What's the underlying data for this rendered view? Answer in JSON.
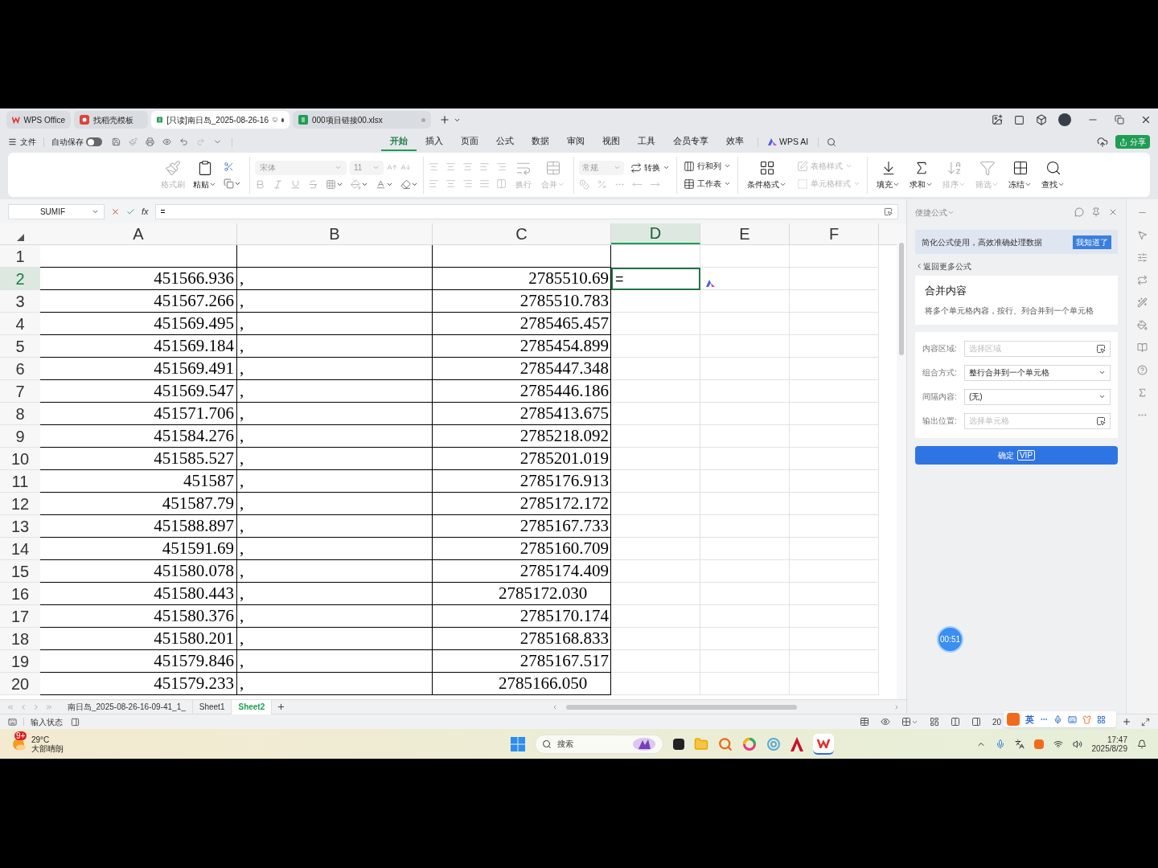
{
  "tabs": [
    {
      "label": "WPS Office",
      "kind": "home",
      "selected": false
    },
    {
      "label": "找稻壳模板",
      "kind": "template",
      "selected": false
    },
    {
      "label": "[只读]南日岛_2025-08-26-16",
      "kind": "sheet",
      "selected": true
    },
    {
      "label": "000项目链接00.xlsx",
      "kind": "sheet",
      "selected": false
    }
  ],
  "menu": {
    "file": "文件",
    "autosave": {
      "label": "自动保存",
      "on": false
    }
  },
  "ribbon_tabs": [
    {
      "label": "开始",
      "selected": true
    },
    {
      "label": "插入",
      "selected": false
    },
    {
      "label": "页面",
      "selected": false
    },
    {
      "label": "公式",
      "selected": false
    },
    {
      "label": "数据",
      "selected": false
    },
    {
      "label": "审阅",
      "selected": false
    },
    {
      "label": "视图",
      "selected": false
    },
    {
      "label": "工具",
      "selected": false
    },
    {
      "label": "会员专享",
      "selected": false
    },
    {
      "label": "效率",
      "selected": false
    }
  ],
  "ai_tab": "WPS AI",
  "share": "分享",
  "ribbon": {
    "groups": [
      {
        "kind": "clipboard",
        "items": [
          {
            "label": "格式刷",
            "disabled": true
          },
          {
            "label": "粘贴",
            "disabled": false
          }
        ]
      },
      {
        "kind": "font",
        "font": "宋体",
        "size": "11"
      },
      {
        "kind": "align",
        "items": [
          {
            "label": "换行",
            "disabled": true
          },
          {
            "label": "合并",
            "disabled": true
          }
        ]
      },
      {
        "kind": "number",
        "format": "常规",
        "items": [
          {
            "label": "转换",
            "disabled": false
          }
        ]
      },
      {
        "kind": "cells",
        "items": [
          {
            "label": "行和列",
            "disabled": false
          },
          {
            "label": "工作表",
            "disabled": false
          }
        ]
      },
      {
        "kind": "styles",
        "items": [
          {
            "label": "条件格式",
            "disabled": false
          },
          {
            "label": "表格样式",
            "disabled": true
          },
          {
            "label": "单元格样式",
            "disabled": true
          }
        ]
      },
      {
        "kind": "edit",
        "items": [
          {
            "label": "填充",
            "disabled": false
          },
          {
            "label": "求和",
            "disabled": false
          },
          {
            "label": "排序",
            "disabled": true
          },
          {
            "label": "筛选",
            "disabled": true
          },
          {
            "label": "冻结",
            "disabled": false
          },
          {
            "label": "查找",
            "disabled": false
          }
        ]
      }
    ]
  },
  "formula_bar": {
    "name_box": "SUMIF",
    "function_label": "fx",
    "formula": "="
  },
  "sheet": {
    "columns": [
      {
        "label": "A",
        "selected": false
      },
      {
        "label": "B",
        "selected": false
      },
      {
        "label": "C",
        "selected": false
      },
      {
        "label": "D",
        "selected": true
      },
      {
        "label": "E",
        "selected": false
      },
      {
        "label": "F",
        "selected": false
      }
    ],
    "active_cell": {
      "value": "="
    },
    "rows": [
      {
        "number": "1",
        "selected": false
      },
      {
        "number": "2",
        "selected": true,
        "a": "451566.936",
        "b": ",",
        "c": "2785510.69",
        "c_left_aligned": false
      },
      {
        "number": "3",
        "selected": false,
        "a": "451567.266",
        "b": ",",
        "c": "2785510.783",
        "c_left_aligned": false
      },
      {
        "number": "4",
        "selected": false,
        "a": "451569.495",
        "b": ",",
        "c": "2785465.457",
        "c_left_aligned": false
      },
      {
        "number": "5",
        "selected": false,
        "a": "451569.184",
        "b": ",",
        "c": "2785454.899",
        "c_left_aligned": false
      },
      {
        "number": "6",
        "selected": false,
        "a": "451569.491",
        "b": ",",
        "c": "2785447.348",
        "c_left_aligned": false
      },
      {
        "number": "7",
        "selected": false,
        "a": "451569.547",
        "b": ",",
        "c": "2785446.186",
        "c_left_aligned": false
      },
      {
        "number": "8",
        "selected": false,
        "a": "451571.706",
        "b": ",",
        "c": "2785413.675",
        "c_left_aligned": false
      },
      {
        "number": "9",
        "selected": false,
        "a": "451584.276",
        "b": ",",
        "c": "2785218.092",
        "c_left_aligned": false
      },
      {
        "number": "10",
        "selected": false,
        "a": "451585.527",
        "b": ",",
        "c": "2785201.019",
        "c_left_aligned": false
      },
      {
        "number": "11",
        "selected": false,
        "a": "451587",
        "b": ",",
        "c": "2785176.913",
        "c_left_aligned": false
      },
      {
        "number": "12",
        "selected": false,
        "a": "451587.79",
        "b": ",",
        "c": "2785172.172",
        "c_left_aligned": false
      },
      {
        "number": "13",
        "selected": false,
        "a": "451588.897",
        "b": ",",
        "c": "2785167.733",
        "c_left_aligned": false
      },
      {
        "number": "14",
        "selected": false,
        "a": "451591.69",
        "b": ",",
        "c": "2785160.709",
        "c_left_aligned": false
      },
      {
        "number": "15",
        "selected": false,
        "a": "451580.078",
        "b": ",",
        "c": "2785174.409",
        "c_left_aligned": false
      },
      {
        "number": "16",
        "selected": false,
        "a": "451580.443",
        "b": ",",
        "c": "2785172.030",
        "c_left_aligned": true
      },
      {
        "number": "17",
        "selected": false,
        "a": "451580.376",
        "b": ",",
        "c": "2785170.174",
        "c_left_aligned": false
      },
      {
        "number": "18",
        "selected": false,
        "a": "451580.201",
        "b": ",",
        "c": "2785168.833",
        "c_left_aligned": false
      },
      {
        "number": "19",
        "selected": false,
        "a": "451579.846",
        "b": ",",
        "c": "2785167.517",
        "c_left_aligned": false
      },
      {
        "number": "20",
        "selected": false,
        "a": "451579.233",
        "b": ",",
        "c": "2785166.050",
        "c_left_aligned": true
      }
    ]
  },
  "panel": {
    "title": "便捷公式",
    "banner": "简化公式使用，高效准确处理数据",
    "banner_button": "我知道了",
    "back": "返回更多公式",
    "card_title": "合并内容",
    "card_desc": "将多个单元格内容，按行、列合并到一个单元格",
    "fields": [
      {
        "label": "内容区域:",
        "kind": "picker",
        "placeholder": "选择区域"
      },
      {
        "label": "组合方式:",
        "kind": "select",
        "value": "整行合并到一个单元格"
      },
      {
        "label": "间隔内容:",
        "kind": "select",
        "value": "(无)"
      },
      {
        "label": "输出位置:",
        "kind": "picker",
        "placeholder": "选择单元格"
      }
    ],
    "confirm": "确定",
    "confirm_badge": "VIP"
  },
  "timer": "00:51",
  "sheet_tabs": [
    {
      "label": "南日岛_2025-08-26-16-09-41_1_",
      "selected": false
    },
    {
      "label": "Sheet1",
      "selected": false
    },
    {
      "label": "Sheet2",
      "selected": true
    }
  ],
  "status_bar": {
    "input_state": "输入状态",
    "zoom": "20"
  },
  "ime": {
    "mode": "英"
  },
  "taskbar": {
    "weather": {
      "temp": "29°C",
      "condition": "大部晴朗",
      "badge": "9+"
    },
    "search": {
      "placeholder": "搜索"
    },
    "time": "17:47",
    "date": "2025/8/29"
  }
}
